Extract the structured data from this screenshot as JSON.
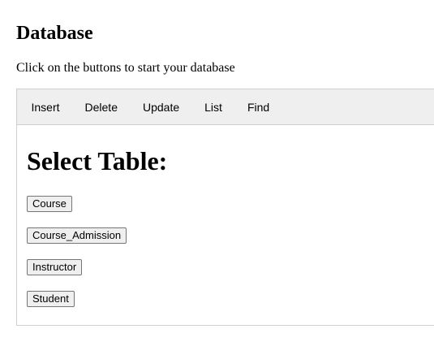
{
  "page": {
    "title": "Database",
    "intro": "Click on the buttons to start your database"
  },
  "tabs": [
    {
      "label": "Insert"
    },
    {
      "label": "Delete"
    },
    {
      "label": "Update"
    },
    {
      "label": "List"
    },
    {
      "label": "Find"
    }
  ],
  "content": {
    "heading": "Select Table:",
    "tables": [
      {
        "label": "Course"
      },
      {
        "label": "Course_Admission"
      },
      {
        "label": "Instructor"
      },
      {
        "label": "Student"
      }
    ]
  }
}
